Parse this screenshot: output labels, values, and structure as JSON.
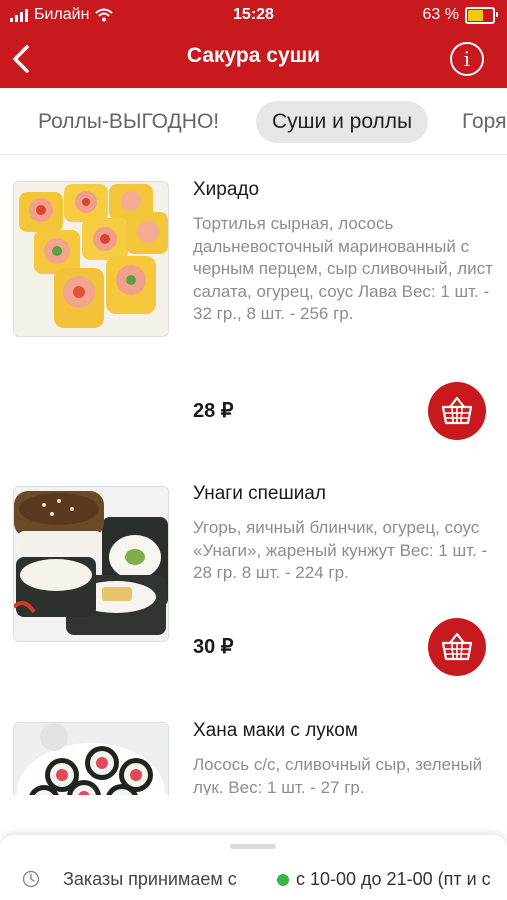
{
  "status_bar": {
    "carrier": "Билайн",
    "time": "15:28",
    "battery": "63 %"
  },
  "header": {
    "title": "Сакура суши"
  },
  "tabs": [
    {
      "label": "Роллы-ВЫГОДНО!"
    },
    {
      "label": "Суши и роллы",
      "active": true
    },
    {
      "label": "Горя"
    }
  ],
  "items": [
    {
      "name": "Хирадо",
      "description": "Тортилья сырная, лосось дальневосточный маринованный с черным перцем, сыр сливочный, лист салата, огурец, соус  Лава Вес: 1 шт. - 32 гр., 8 шт. - 256 гр.",
      "price": "28 ₽"
    },
    {
      "name": "Унаги спешиал",
      "description": "Угорь, яичный блинчик, огурец, соус «Унаги», жареный кунжут Вес: 1 шт. - 28 гр. 8 шт. - 224 гр.",
      "price": "30 ₽"
    },
    {
      "name": "Хана маки с луком",
      "description": "Лосось с/с, сливочный сыр, зеленый лук. Вес: 1 шт. - 27 гр."
    }
  ],
  "bottom_sheet": {
    "orders_label": "Заказы принимаем с",
    "hours": "с 10-00 до 21-00 (пт и с"
  },
  "colors": {
    "brand_red": "#c8191e",
    "open_status_green": "#39b54a"
  }
}
